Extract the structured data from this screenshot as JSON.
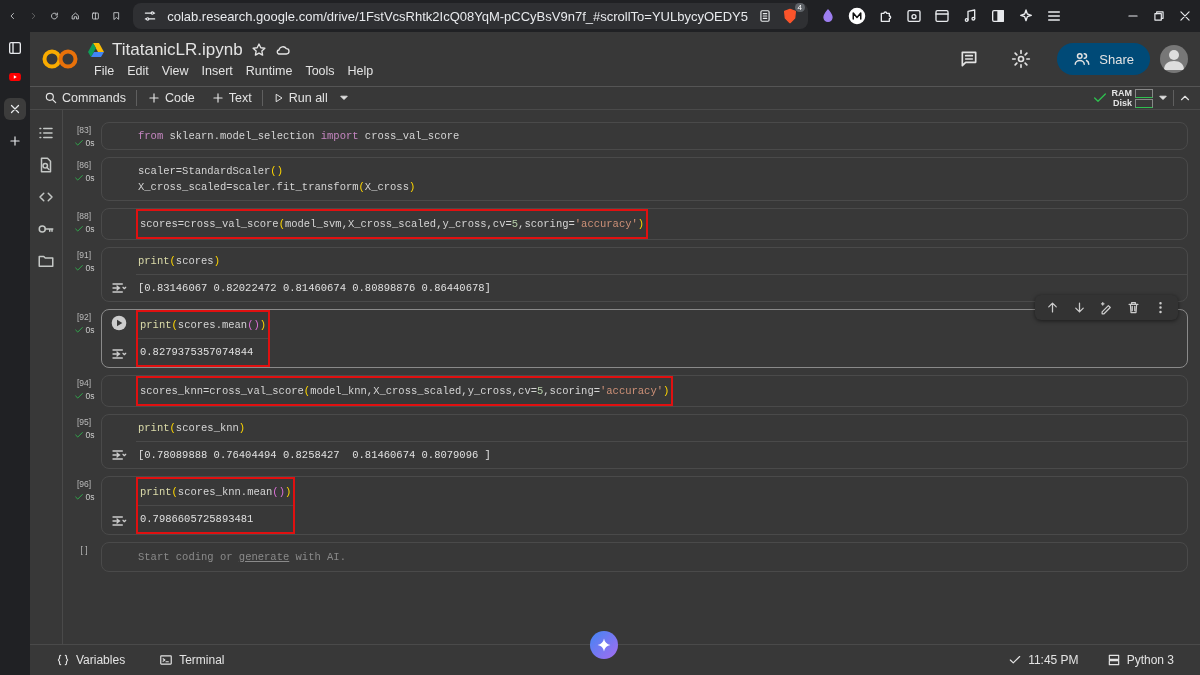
{
  "browser": {
    "url": "colab.research.google.com/drive/1FstVcsRhtk2IcQ08YqM-pCCyBsV9n7f_#scrollTo=YULbycyOEDY5",
    "shield_badge": "4"
  },
  "notebook": {
    "title": "TitatanicLR.ipynb",
    "menu": [
      "File",
      "Edit",
      "View",
      "Insert",
      "Runtime",
      "Tools",
      "Help"
    ],
    "share": "Share"
  },
  "toolbar": {
    "items": [
      {
        "kind": "search",
        "label": "Commands"
      },
      {
        "kind": "add",
        "label": "Code"
      },
      {
        "kind": "add",
        "label": "Text"
      },
      {
        "kind": "run",
        "label": "Run all"
      }
    ],
    "resources": [
      "RAM",
      "Disk"
    ]
  },
  "cells": [
    {
      "count": "[83]",
      "status": "0s",
      "focused": false,
      "lines": [
        [
          {
            "t": "from",
            "kind": "keyword"
          },
          {
            "t": " sklearn.model_selection ",
            "kind": "plain"
          },
          {
            "t": "import",
            "kind": "keyword"
          },
          {
            "t": " cross_val_score",
            "kind": "plain"
          }
        ]
      ]
    },
    {
      "count": "[86]",
      "status": "0s",
      "focused": false,
      "lines": [
        [
          {
            "t": "scaler=StandardScaler",
            "kind": "plain"
          },
          {
            "t": "()",
            "kind": "paren"
          }
        ],
        [
          {
            "t": "X_cross_scaled=scaler.fit_transform",
            "kind": "plain"
          },
          {
            "t": "(",
            "kind": "paren"
          },
          {
            "t": "X_cross",
            "kind": "plain"
          },
          {
            "t": ")",
            "kind": "paren"
          }
        ]
      ]
    },
    {
      "count": "[88]",
      "status": "0s",
      "focused": false,
      "highlight": {
        "kind": "code"
      },
      "lines": [
        [
          {
            "t": "scores=cross_val_score",
            "kind": "plain"
          },
          {
            "t": "(",
            "kind": "paren"
          },
          {
            "t": "model_svm,X_cross_scaled,y_cross,cv=",
            "kind": "plain"
          },
          {
            "t": "5",
            "kind": "number"
          },
          {
            "t": ",scoring=",
            "kind": "plain"
          },
          {
            "t": "'accuracy'",
            "kind": "string"
          },
          {
            "t": ")",
            "kind": "paren"
          }
        ]
      ]
    },
    {
      "count": "[91]",
      "status": "0s",
      "focused": false,
      "lines": [
        [
          {
            "t": "print",
            "kind": "func"
          },
          {
            "t": "(",
            "kind": "paren"
          },
          {
            "t": "scores",
            "kind": "plain"
          },
          {
            "t": ")",
            "kind": "paren"
          }
        ]
      ],
      "output": "[0.83146067 0.82022472 0.81460674 0.80898876 0.86440678]"
    },
    {
      "count": "[92]",
      "status": "0s",
      "focused": true,
      "highlight": {
        "kind": "cell"
      },
      "lines": [
        [
          {
            "t": "print",
            "kind": "func"
          },
          {
            "t": "(",
            "kind": "paren"
          },
          {
            "t": "scores.mean",
            "kind": "plain"
          },
          {
            "t": "()",
            "kind": "paren2"
          },
          {
            "t": ")",
            "kind": "paren"
          }
        ]
      ],
      "output": "0.8279375357074844"
    },
    {
      "count": "[94]",
      "status": "0s",
      "focused": false,
      "highlight": {
        "kind": "code"
      },
      "lines": [
        [
          {
            "t": "scores_knn=cross_val_score",
            "kind": "plain"
          },
          {
            "t": "(",
            "kind": "paren"
          },
          {
            "t": "model_knn,X_cross_scaled,y_cross,cv=",
            "kind": "plain"
          },
          {
            "t": "5",
            "kind": "number"
          },
          {
            "t": ",scoring=",
            "kind": "plain"
          },
          {
            "t": "'accuracy'",
            "kind": "string"
          },
          {
            "t": ")",
            "kind": "paren"
          }
        ]
      ]
    },
    {
      "count": "[95]",
      "status": "0s",
      "focused": false,
      "lines": [
        [
          {
            "t": "print",
            "kind": "func"
          },
          {
            "t": "(",
            "kind": "paren"
          },
          {
            "t": "scores_knn",
            "kind": "plain"
          },
          {
            "t": ")",
            "kind": "paren"
          }
        ]
      ],
      "output": "[0.78089888 0.76404494 0.8258427  0.81460674 0.8079096 ]"
    },
    {
      "count": "[96]",
      "status": "0s",
      "focused": false,
      "highlight": {
        "kind": "cell"
      },
      "lines": [
        [
          {
            "t": "print",
            "kind": "func"
          },
          {
            "t": "(",
            "kind": "paren"
          },
          {
            "t": "scores_knn.mean",
            "kind": "plain"
          },
          {
            "t": "()",
            "kind": "paren2"
          },
          {
            "t": ")",
            "kind": "paren"
          }
        ]
      ],
      "output": "0.7986605725893481"
    }
  ],
  "empty_cell": {
    "count": "[ ]",
    "before": "Start coding or",
    "link": "generate",
    "after": "with AI."
  },
  "status_bar": {
    "items": [
      {
        "kind": "variables",
        "label": "Variables"
      },
      {
        "kind": "terminal",
        "label": "Terminal"
      }
    ],
    "time": "11:45 PM",
    "runtime": "Python 3"
  }
}
